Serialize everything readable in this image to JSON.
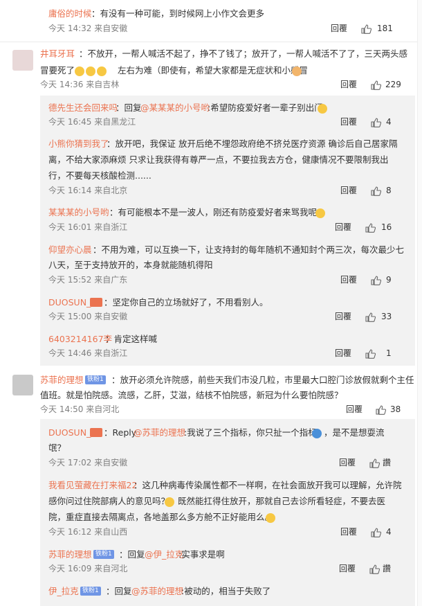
{
  "c0": {
    "name": "庸俗的时候",
    "body": "：有没有一种可能，到时候网上小作文会更多",
    "meta": "今天 14:32 来自安徽",
    "reply": "回覆",
    "likes": "181"
  },
  "c1": {
    "name": "井耳牙耳",
    "body1": "：不放开，一帮人喊活不起了，挣不了钱了；放开了，一帮人喊活不了了，三天两头感",
    "body2": "冒要死了",
    "body2b": "左右为难（即使有，希望大家都是无症状和小感冒",
    "meta": "今天 14:36 来自吉林",
    "reply": "回覆",
    "likes": "229"
  },
  "r1": {
    "name": "德先生还会回来吗",
    "pre": "：回复",
    "mention": "@某某某的小号哟",
    "post": ":希望防疫爱好者一辈子别出门",
    "meta": "今天 16:45 来自黑龙江",
    "reply": "回覆",
    "likes": "4"
  },
  "r2": {
    "name": "小熊你猜到我了",
    "l1": "：放开吧，我保证 放开后绝不埋怨政府绝不挤兑医疗资源 确诊后自己居家隔",
    "l2": "离，不给大家添麻烦 只求让我获得有尊严一点，不要拉我去方仓，健康情况不要限制我出",
    "l3": "行，不要每天核酸检测......",
    "meta": "今天 16:14 来自北京",
    "reply": "回覆",
    "likes": "8"
  },
  "r3": {
    "name": "某某某的小号哟",
    "body": "：有可能根本不是一波人，刚还有防疫爱好者来骂我呢，",
    "meta": "今天 16:01 来自浙江",
    "reply": "回覆",
    "likes": "16"
  },
  "r4": {
    "name": "仰望亦心晨",
    "l1": "：不用为难，可以互换一下，让支持封的每年随机不通知封个两三次，每次最少七",
    "l2": "八天，至于支持放开的，本身就能随机得阳",
    "meta": "今天 15:52 来自广东",
    "reply": "回覆",
    "likes": "9"
  },
  "r5": {
    "name": "DUOSUN_",
    "body": "：坚定你自己的立场就好了，不用看别人。",
    "meta": "今天 15:00 来自安徽",
    "reply": "回覆",
    "likes": "33"
  },
  "r6": {
    "name": "6403214167李",
    "body": "：肯定这样喊",
    "meta": "今天 14:46 来自浙江",
    "reply": "回覆",
    "likes": "1"
  },
  "c2": {
    "name": "苏菲的理想",
    "badge": "铁粉1",
    "l1": "：放开必须允许院感，前些天我们市没几粒，市里最大口腔门诊放假就剩个主任",
    "l2": "值班。就是怕院感。流感，乙肝，艾滋，结核不怕院感，新冠为什么要怕院感？",
    "meta": "今天 14:50 来自河北",
    "reply": "回覆",
    "likes": "38"
  },
  "s1": {
    "name": "DUOSUN_",
    "pre": "：Reply ",
    "mention": "@苏菲的理想",
    "post": ":我说了三个指标，你只扯一个指标",
    "post2": "，是不是想耍流",
    "l2": "氓？",
    "meta": "今天 17:02 来自安徽",
    "reply": "回覆",
    "likes": "讚"
  },
  "s2": {
    "name": "我看见萤藏在打来福22",
    "l1": "：这几种病毒传染属性都不一样啊，在社会面放开我可以理解，允许院",
    "l2": "感你问过住院部病人的意见吗？",
    "l2b": "既然能扛得住放开，那就自己去诊所看轻症，不要去医",
    "l3": "院，重症直接去隔离点，各地盖那么多方舱不正好能用么。",
    "meta": "今天 16:12 来自山西",
    "reply": "回覆",
    "likes": "4"
  },
  "s3": {
    "name": "苏菲的理想",
    "badge": "铁粉1",
    "pre": "：回复",
    "mention": "@伊_拉克",
    "post": ":实事求是啊",
    "meta": "今天 16:09 来自河北",
    "reply": "回覆",
    "likes": "讚"
  },
  "s4": {
    "name": "伊_拉克",
    "badge": "铁粉1",
    "pre": "：回复",
    "mention": "@苏菲的理想",
    "post": ":被动的，相当于失败了"
  }
}
